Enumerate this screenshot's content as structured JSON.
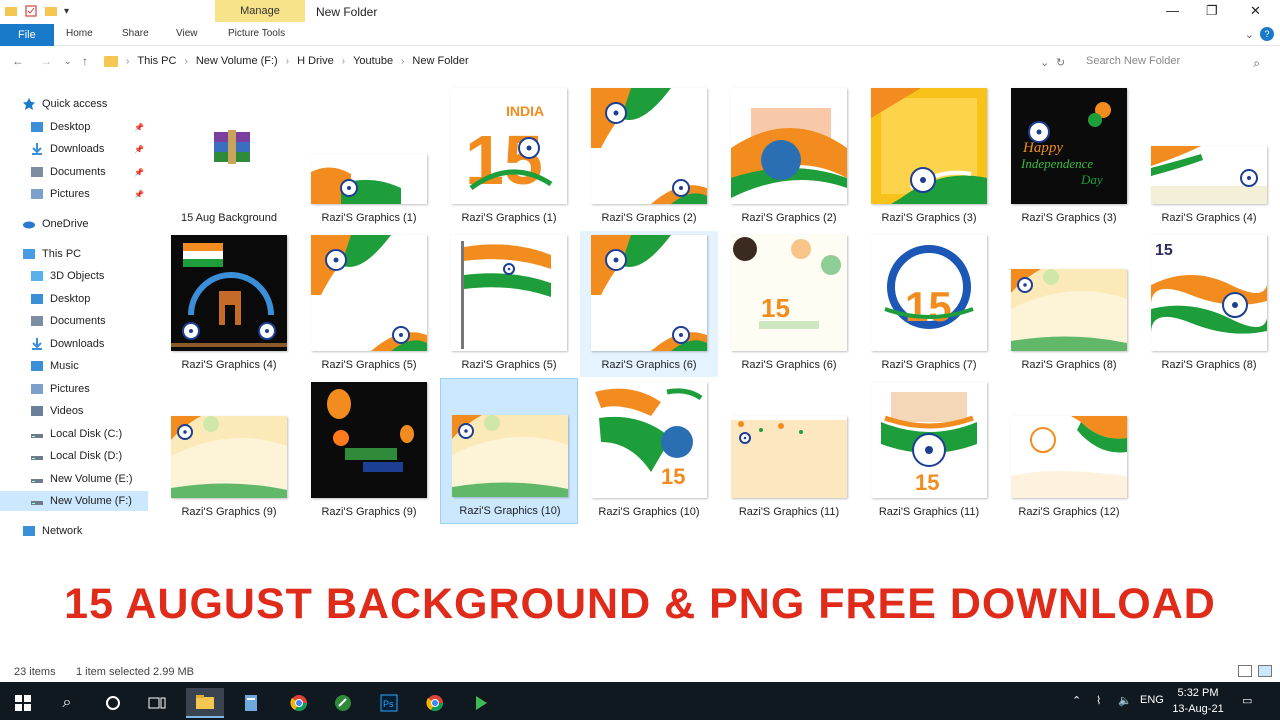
{
  "window": {
    "title": "New Folder",
    "manage_tab": "Manage",
    "minimize": "—",
    "maximize": "❐",
    "close": "✕"
  },
  "ribbon": {
    "tabs": [
      "File",
      "Home",
      "Share",
      "View",
      "Picture Tools"
    ],
    "help": "?"
  },
  "address": {
    "crumbs": [
      "This PC",
      "New Volume (F:)",
      "H Drive",
      "Youtube",
      "New Folder"
    ],
    "search_placeholder": "Search New Folder"
  },
  "nav": {
    "items": [
      {
        "label": "Quick access",
        "icon": "star-icon",
        "pinned": false
      },
      {
        "label": "Desktop",
        "icon": "desktop-icon",
        "pinned": true
      },
      {
        "label": "Downloads",
        "icon": "download-icon",
        "pinned": true
      },
      {
        "label": "Documents",
        "icon": "document-icon",
        "pinned": true
      },
      {
        "label": "Pictures",
        "icon": "pictures-icon",
        "pinned": true
      },
      {
        "label": "OneDrive",
        "icon": "cloud-icon",
        "pinned": false
      },
      {
        "label": "This PC",
        "icon": "computer-icon",
        "pinned": false
      },
      {
        "label": "3D Objects",
        "icon": "cube-icon",
        "pinned": false
      },
      {
        "label": "Desktop",
        "icon": "desktop-icon",
        "pinned": false
      },
      {
        "label": "Documents",
        "icon": "document-icon",
        "pinned": false
      },
      {
        "label": "Downloads",
        "icon": "download-icon",
        "pinned": false
      },
      {
        "label": "Music",
        "icon": "music-icon",
        "pinned": false
      },
      {
        "label": "Pictures",
        "icon": "pictures-icon",
        "pinned": false
      },
      {
        "label": "Videos",
        "icon": "video-icon",
        "pinned": false
      },
      {
        "label": "Local Disk (C:)",
        "icon": "drive-icon",
        "pinned": false
      },
      {
        "label": "Local Disk (D:)",
        "icon": "drive-icon",
        "pinned": false
      },
      {
        "label": "New Volume (E:)",
        "icon": "drive-icon",
        "pinned": false
      },
      {
        "label": "New Volume (F:)",
        "icon": "drive-icon",
        "pinned": false
      },
      {
        "label": "Network",
        "icon": "network-icon",
        "pinned": false
      }
    ]
  },
  "files": [
    {
      "name": "15 Aug Background",
      "type": "archive"
    },
    {
      "name": "Razi'S Graphics (1)",
      "type": "flag-corner"
    },
    {
      "name": "Razi'S Graphics (1)",
      "type": "india-15"
    },
    {
      "name": "Razi'S Graphics (2)",
      "type": "tricolor-frame"
    },
    {
      "name": "Razi'S Graphics (2)",
      "type": "fort-wave"
    },
    {
      "name": "Razi'S Graphics (3)",
      "type": "yellow-card"
    },
    {
      "name": "Razi'S Graphics (3)",
      "type": "dark-poster"
    },
    {
      "name": "Razi'S Graphics (4)",
      "type": "banner-flag"
    },
    {
      "name": "Razi'S Graphics (4)",
      "type": "dark-gate"
    },
    {
      "name": "Razi'S Graphics (5)",
      "type": "tricolor-frame"
    },
    {
      "name": "Razi'S Graphics (5)",
      "type": "waving-flag"
    },
    {
      "name": "Razi'S Graphics (6)",
      "type": "tricolor-frame"
    },
    {
      "name": "Razi'S Graphics (6)",
      "type": "balloons-15"
    },
    {
      "name": "Razi'S Graphics (7)",
      "type": "chakra-15"
    },
    {
      "name": "Razi'S Graphics (8)",
      "type": "light-banner"
    },
    {
      "name": "Razi'S Graphics (8)",
      "type": "wave-15"
    },
    {
      "name": "Razi'S Graphics (9)",
      "type": "light-banner"
    },
    {
      "name": "Razi'S Graphics (9)",
      "type": "dark-balloons"
    },
    {
      "name": "Razi'S Graphics (10)",
      "type": "light-banner"
    },
    {
      "name": "Razi'S Graphics (10)",
      "type": "flag-15"
    },
    {
      "name": "Razi'S Graphics (11)",
      "type": "cream-banner"
    },
    {
      "name": "Razi'S Graphics (11)",
      "type": "chakra-15b"
    },
    {
      "name": "Razi'S Graphics (12)",
      "type": "stripe-corner"
    }
  ],
  "headline": "15 AUGUST BACKGROUND & PNG FREE DOWNLOAD",
  "status": {
    "count": "23 items",
    "selected": "1 item selected  2.99 MB"
  },
  "taskbar": {
    "lang": "ENG",
    "time": "5:32 PM",
    "date": "13-Aug-21"
  },
  "colors": {
    "saffron": "#f28c1e",
    "green": "#1e9e3a",
    "chakra": "#1c3f94",
    "headline": "#e02a1a",
    "selection": "#cce8ff",
    "file_tab": "#1979ca"
  }
}
